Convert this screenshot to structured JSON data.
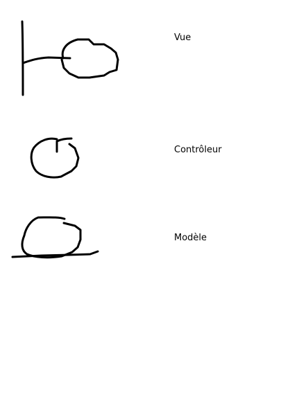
{
  "labels": {
    "view": "Vue",
    "controller": "Contrôleur",
    "model": "Modèle"
  },
  "icons": {
    "view": "boundary-icon",
    "controller": "control-icon",
    "model": "entity-icon"
  },
  "colors": {
    "background": "#ffffff",
    "stroke": "#000000"
  }
}
